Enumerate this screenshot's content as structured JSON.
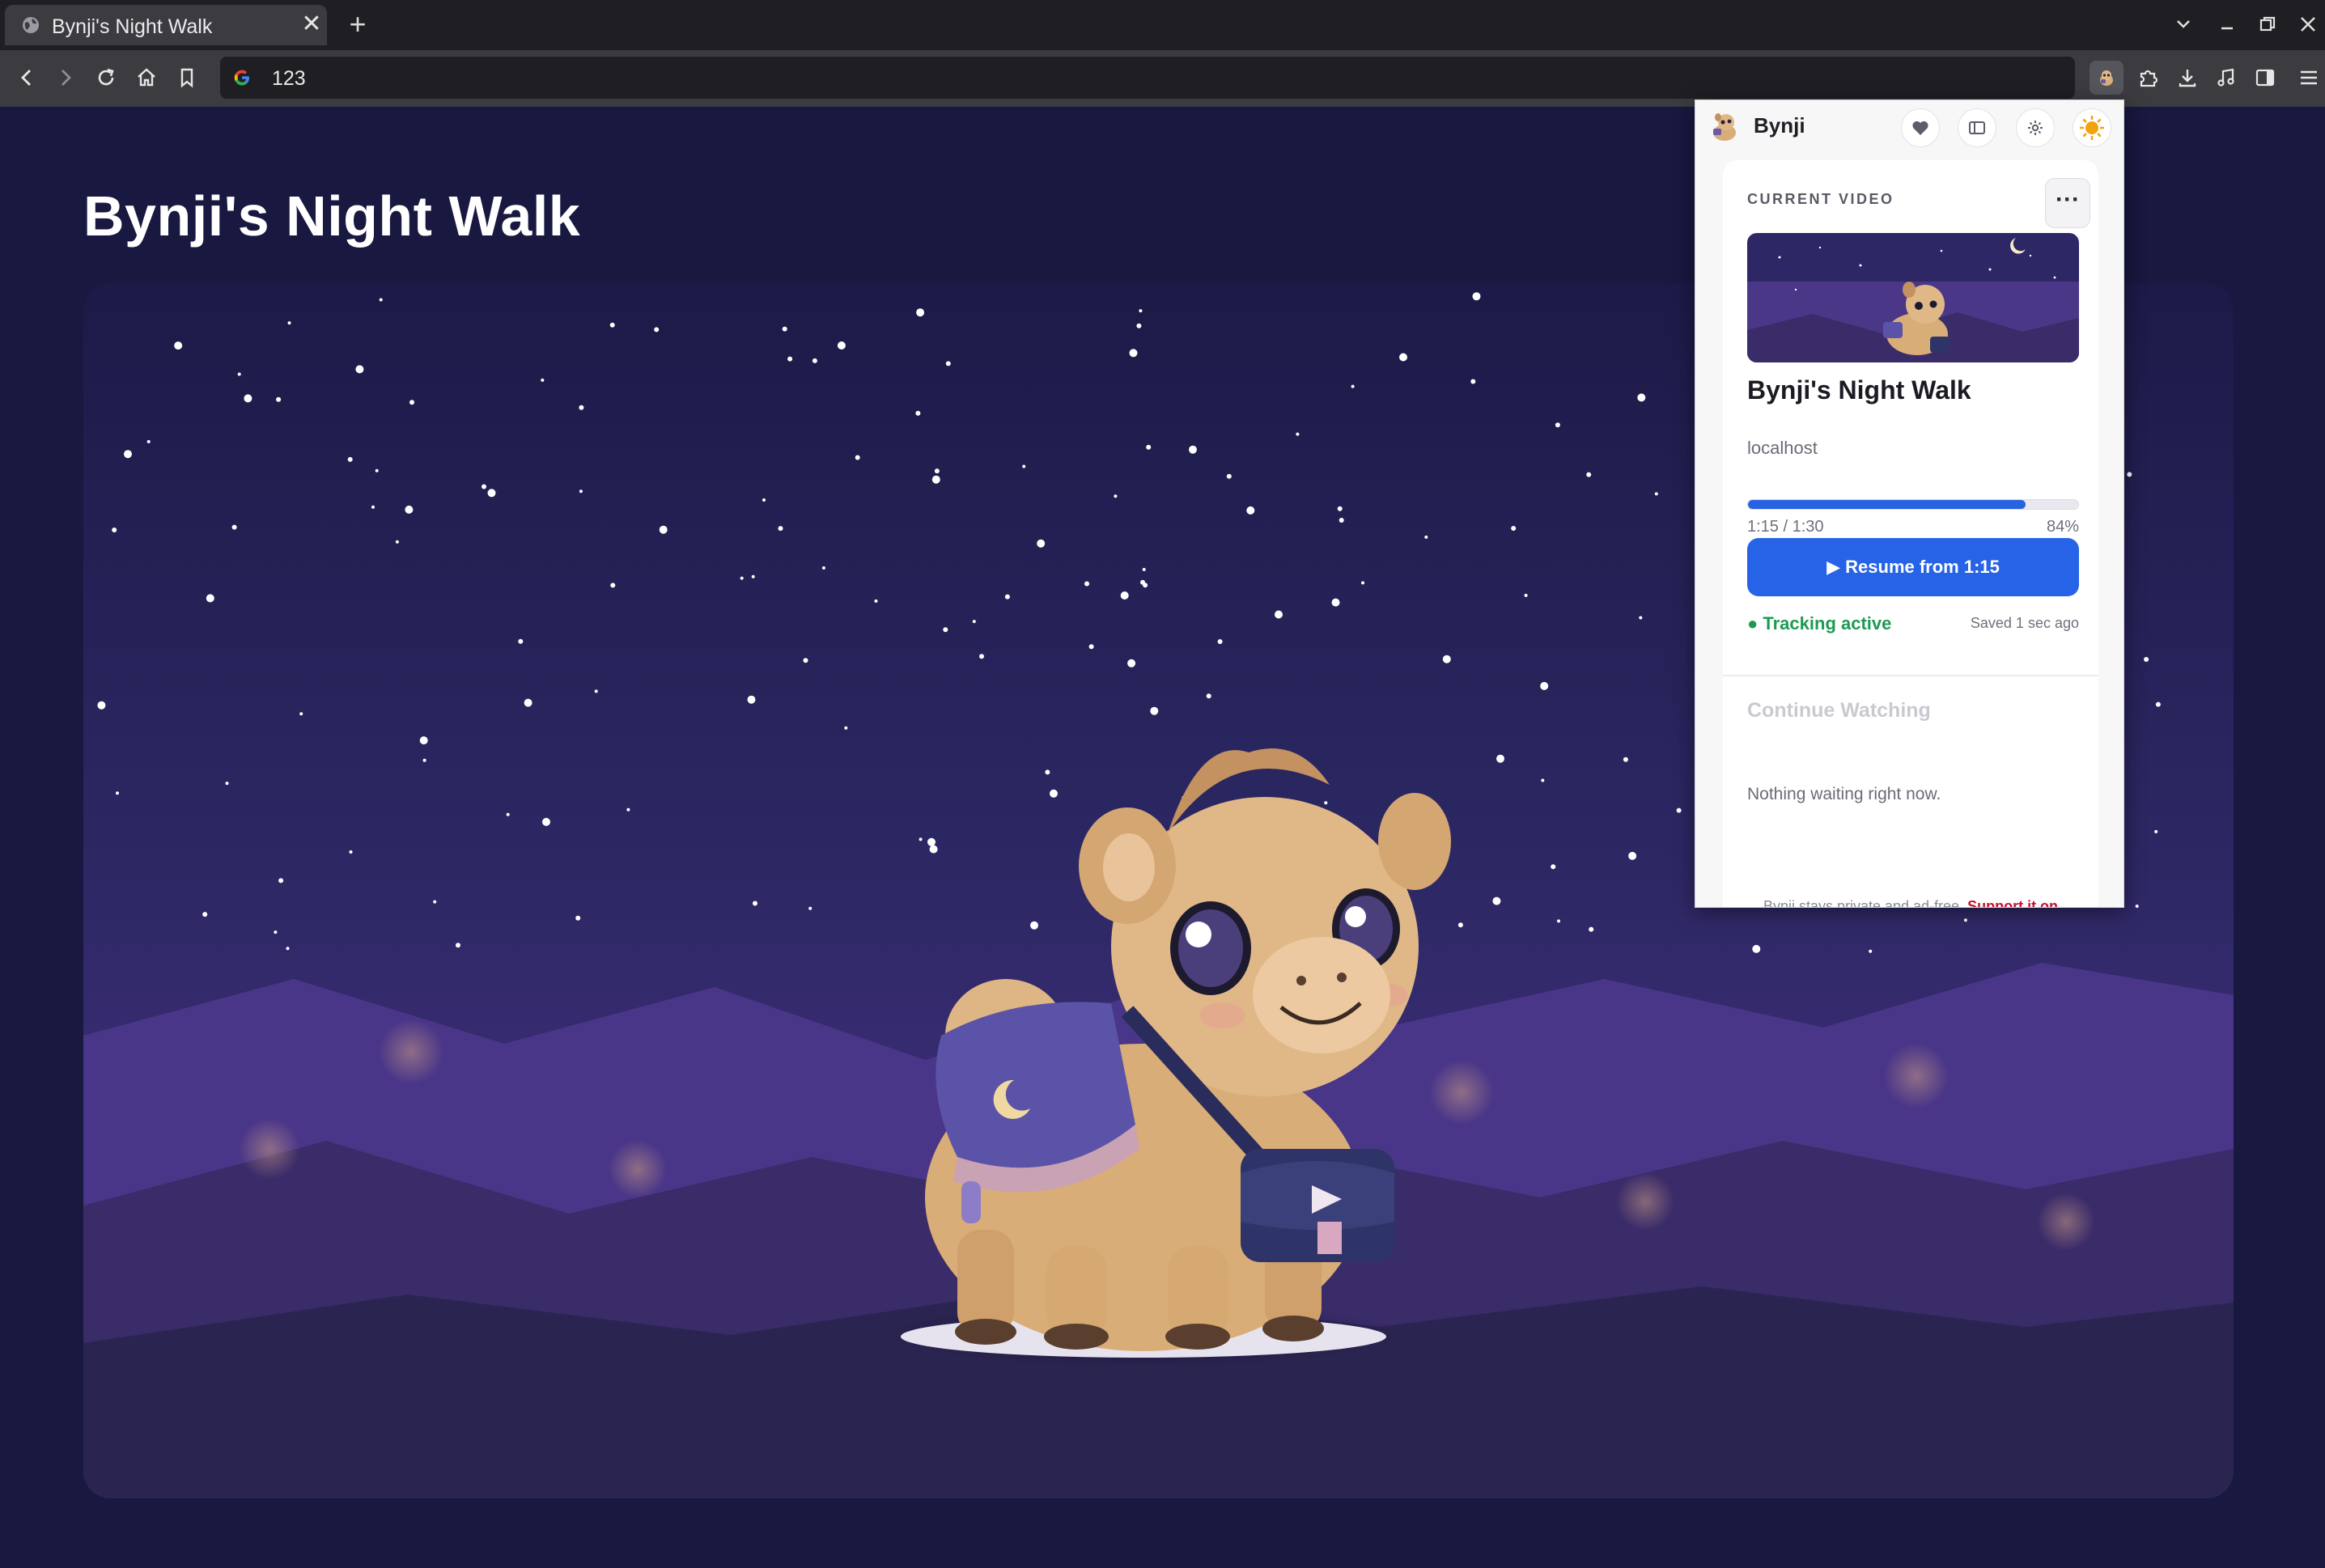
{
  "browser": {
    "tab_title": "Bynji's Night Walk",
    "tab_close": "✕",
    "new_tab": "+",
    "url": "123"
  },
  "page": {
    "title": "Bynji's Night Walk"
  },
  "extension": {
    "brand": "Bynji",
    "section_label": "CURRENT VIDEO",
    "more_label": "···",
    "video_title": "Bynji's Night Walk",
    "host": "localhost",
    "progress": {
      "time": "1:15 / 1:30",
      "percent_label": "84%",
      "fraction": 0.84
    },
    "resume_label": "▶ Resume from 1:15",
    "tracking_status": "● Tracking active",
    "saved_status": "Saved 1 sec ago",
    "continue_title": "Continue Watching",
    "continue_empty": "Nothing waiting right now.",
    "footer_text": "Bynji stays private and ad-free.",
    "footer_link": "Support it on"
  },
  "colors": {
    "accent": "#2663e6",
    "tracking": "#1d9a52",
    "support_link": "#c8102e"
  }
}
